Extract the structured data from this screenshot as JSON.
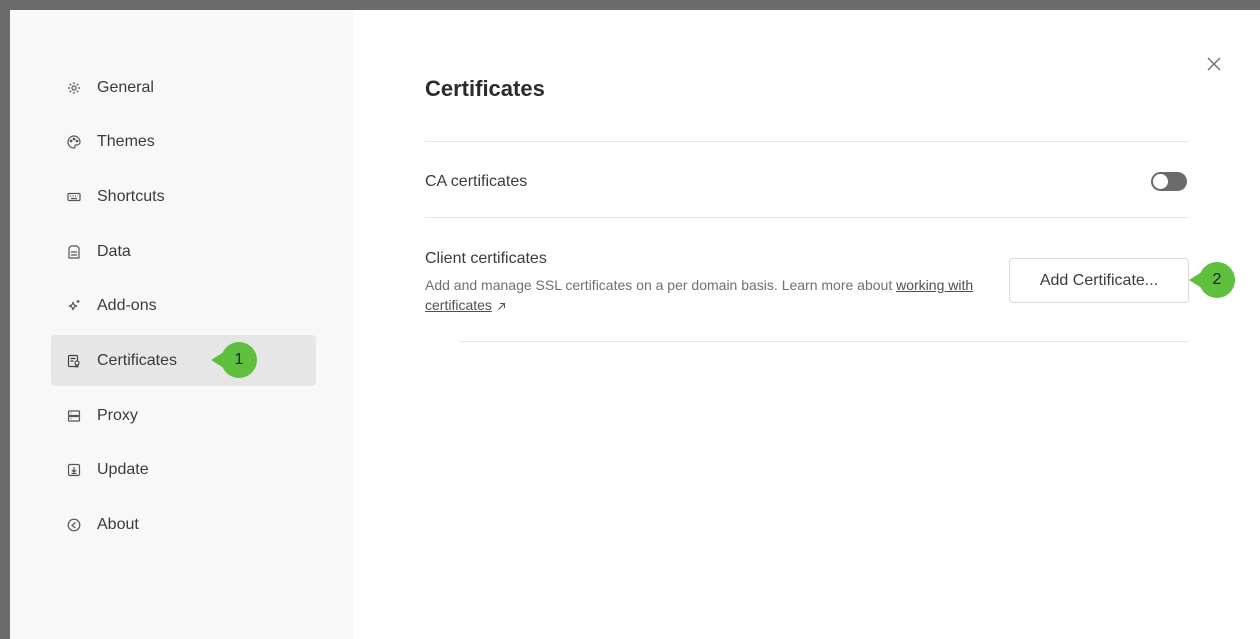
{
  "sidebar": {
    "items": [
      {
        "label": "General",
        "icon": "gear-icon"
      },
      {
        "label": "Themes",
        "icon": "palette-icon"
      },
      {
        "label": "Shortcuts",
        "icon": "keyboard-icon"
      },
      {
        "label": "Data",
        "icon": "data-icon"
      },
      {
        "label": "Add-ons",
        "icon": "sparkle-icon"
      },
      {
        "label": "Certificates",
        "icon": "certificate-icon",
        "active": true
      },
      {
        "label": "Proxy",
        "icon": "server-icon"
      },
      {
        "label": "Update",
        "icon": "download-icon"
      },
      {
        "label": "About",
        "icon": "info-icon"
      }
    ]
  },
  "annotations": {
    "step1": "1",
    "step2": "2",
    "color": "#5fbf3f"
  },
  "main": {
    "title": "Certificates",
    "ca": {
      "label": "CA certificates",
      "enabled": false
    },
    "client": {
      "label": "Client certificates",
      "description": "Add and manage SSL certificates on a per domain basis. Learn more about ",
      "link_text": "working with certificates",
      "button_label": "Add Certificate..."
    }
  },
  "colors": {
    "backdrop": "#6b6b6b",
    "sidebar_bg": "#f8f8f8",
    "active_item_bg": "#e6e6e6",
    "toggle_off": "#6b6b6b"
  }
}
